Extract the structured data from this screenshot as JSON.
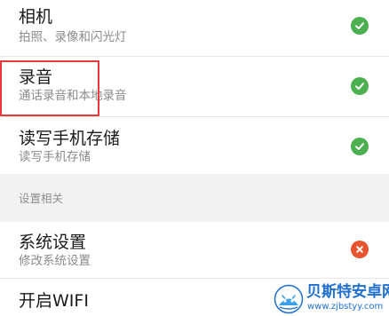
{
  "permissions": [
    {
      "title": "相机",
      "subtitle": "拍照、录像和闪光灯",
      "status": "allowed"
    },
    {
      "title": "录音",
      "subtitle": "通话录音和本地录音",
      "status": "allowed"
    },
    {
      "title": "读写手机存储",
      "subtitle": "读写手机存储",
      "status": "allowed"
    }
  ],
  "section_header": "设置相关",
  "settings": [
    {
      "title": "系统设置",
      "subtitle": "修改系统设置",
      "status": "denied"
    },
    {
      "title": "开启WIFI",
      "subtitle": "",
      "status": ""
    }
  ],
  "watermark": {
    "name": "贝斯特安卓网",
    "url": "www.zjbstyy.com"
  },
  "colors": {
    "allowed": "#4caf50",
    "denied": "#e8542f",
    "highlight": "#e5393c",
    "watermark": "#1f6fd1"
  },
  "icons": {
    "allowed": "check-icon",
    "denied": "close-icon"
  }
}
